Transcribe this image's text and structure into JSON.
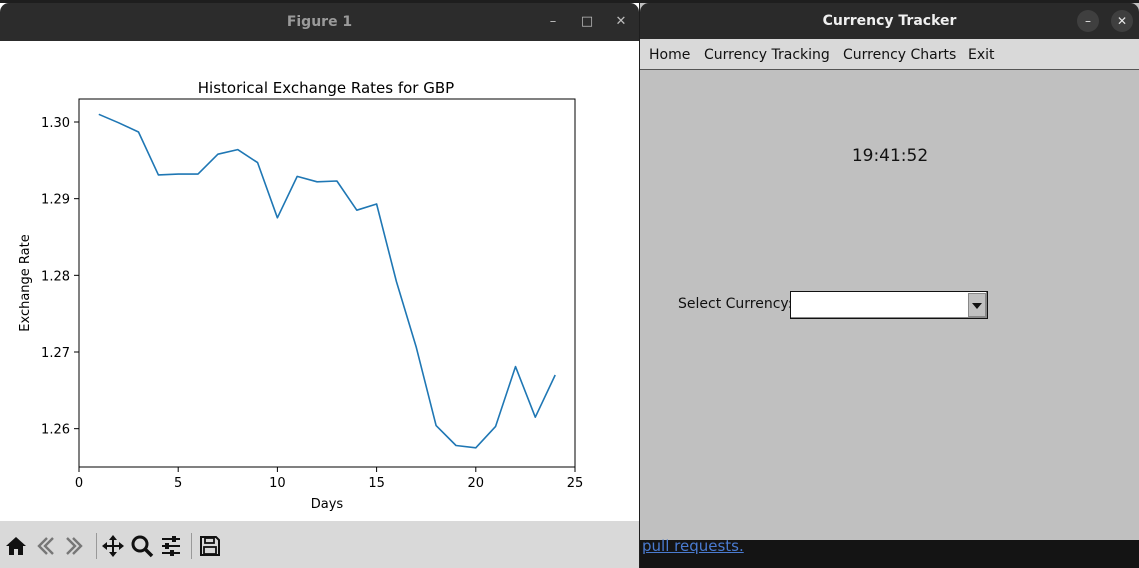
{
  "figure_window": {
    "title": "Figure 1",
    "controls": {
      "minimize": "–",
      "maximize": "□",
      "close": "✕"
    },
    "toolbar_icons": [
      "home-icon",
      "back-arrow-icon",
      "forward-arrow-icon",
      "pan-icon",
      "zoom-icon",
      "configure-subplots-icon",
      "save-icon"
    ]
  },
  "chart_data": {
    "type": "line",
    "title": "Historical Exchange Rates for GBP",
    "xlabel": "Days",
    "ylabel": "Exchange Rate",
    "xlim": [
      0,
      25
    ],
    "ylim": [
      1.255,
      1.303
    ],
    "xticks": [
      0,
      5,
      10,
      15,
      20,
      25
    ],
    "yticks": [
      1.26,
      1.27,
      1.28,
      1.29,
      1.3
    ],
    "ytick_labels": [
      "1.26",
      "1.27",
      "1.28",
      "1.29",
      "1.30"
    ],
    "line_color": "#1f77b4",
    "grid": false,
    "series": [
      {
        "x": [
          1,
          2,
          3,
          4,
          5,
          6,
          7,
          8,
          9,
          10,
          11,
          12,
          13,
          14,
          15,
          16,
          17,
          18,
          19,
          20,
          21,
          22,
          23,
          24
        ],
        "values": [
          1.301,
          1.2999,
          1.2987,
          1.2931,
          1.2932,
          1.2932,
          1.2958,
          1.2964,
          1.2947,
          1.2875,
          1.2929,
          1.2922,
          1.2923,
          1.2885,
          1.2893,
          1.2792,
          1.2706,
          1.2604,
          1.2578,
          1.2575,
          1.2603,
          1.2681,
          1.2615,
          1.267
        ]
      }
    ]
  },
  "tracker_window": {
    "title": "Currency Tracker",
    "controls": {
      "minimize": "–",
      "close": "✕"
    },
    "menu": [
      "Home",
      "Currency Tracking",
      "Currency Charts",
      "Exit"
    ],
    "clock": "19:41:52",
    "select_label": "Select Currency:",
    "select_value": ""
  },
  "background": {
    "link_text": "pull requests."
  }
}
